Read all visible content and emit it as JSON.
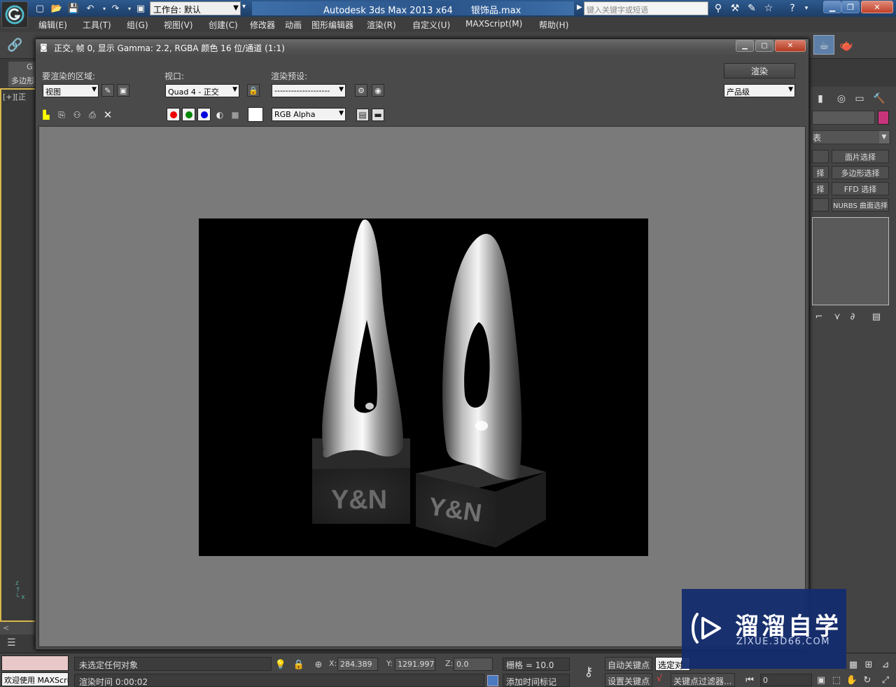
{
  "app": {
    "title": "Autodesk 3ds Max  2013 x64",
    "file": "银饰品.max",
    "workspace": "工作台: 默认",
    "search_placeholder": "键入关键字或短语"
  },
  "menu": [
    "编辑(E)",
    "工具(T)",
    "组(G)",
    "视图(V)",
    "创建(C)",
    "修改器",
    "动画",
    "图形编辑器",
    "渲染(R)",
    "自定义(U)",
    "MAXScript(M)",
    "帮助(H)"
  ],
  "left_panel": {
    "tab1": "G",
    "tab2": "多边形",
    "viewport_label": "[+][正"
  },
  "command_panel": {
    "color_swatch": "#c8347a",
    "modifier_list": "表",
    "buttons": [
      {
        "label": "面片选择"
      },
      {
        "label": "择"
      },
      {
        "label": "多边形选择"
      },
      {
        "label": "择"
      },
      {
        "label": "FFD 选择"
      },
      {
        "label": "NURBS 曲面选择"
      }
    ]
  },
  "render_dialog": {
    "title": "正交, 帧 0, 显示 Gamma: 2.2, RGBA 颜色 16 位/通道 (1:1)",
    "area_label": "要渲染的区域:",
    "area_value": "视图",
    "viewport_label": "视口:",
    "viewport_value": "Quad 4 - 正交",
    "preset_label": "渲染预设:",
    "preset_value": "--------------------",
    "render_button": "渲染",
    "quality_value": "产品级",
    "channel_value": "RGB Alpha"
  },
  "rendered_scene": {
    "left_base_text": "Y&N",
    "right_base_text": "Y&N"
  },
  "status": {
    "selection": "未选定任何对象",
    "render_time": "渲染时间  0:00:02",
    "welcome": "欢迎使用 MAXScript",
    "x_label": "X:",
    "x_value": "284.389",
    "y_label": "Y:",
    "y_value": "1291.997",
    "z_label": "Z:",
    "z_value": "0.0",
    "grid": "栅格 = 10.0",
    "add_time_tag": "添加时间标记",
    "auto_key": "自动关键点",
    "set_key": "设置关键点",
    "selected_set": "选定对",
    "key_filters": "关键点过滤器...",
    "frame": "0"
  },
  "watermark": {
    "name": "溜溜自学",
    "url": "ZIXUE.3D66.COM"
  }
}
